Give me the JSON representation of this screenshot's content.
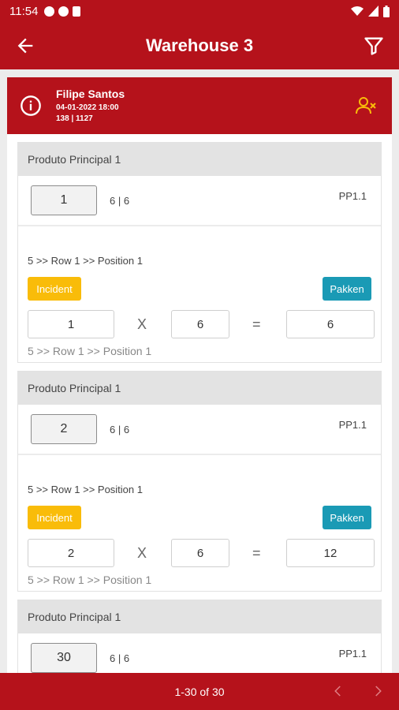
{
  "status": {
    "time": "11:54"
  },
  "appbar": {
    "title": "Warehouse 3"
  },
  "header": {
    "name": "Filipe Santos",
    "datetime": "04-01-2022 18:00",
    "ids": "138 | 1127"
  },
  "items": [
    {
      "product": "Produto Principal 1",
      "qty": "1",
      "ratio": "6 | 6",
      "code": "PP1.1",
      "location": "5 >> Row 1 >> Position 1",
      "incident_label": "Incident",
      "pakken_label": "Pakken",
      "factor_a": "1",
      "multiplier": "6",
      "result": "6",
      "location2": "5 >> Row 1 >> Position 1"
    },
    {
      "product": "Produto Principal 1",
      "qty": "2",
      "ratio": "6 | 6",
      "code": "PP1.1",
      "location": "5 >> Row 1 >> Position 1",
      "incident_label": "Incident",
      "pakken_label": "Pakken",
      "factor_a": "2",
      "multiplier": "6",
      "result": "12",
      "location2": "5 >> Row 1 >> Position 1"
    },
    {
      "product": "Produto Principal 1",
      "qty": "30",
      "ratio": "6 | 6",
      "code": "PP1.1"
    }
  ],
  "operators": {
    "multiply": "X",
    "equals": "="
  },
  "footer": {
    "range": "1-30 of 30"
  },
  "colors": {
    "primary": "#b5121b",
    "incident": "#f9bc09",
    "pakken": "#1a9ab5",
    "header_icon": "#f9bc09"
  }
}
